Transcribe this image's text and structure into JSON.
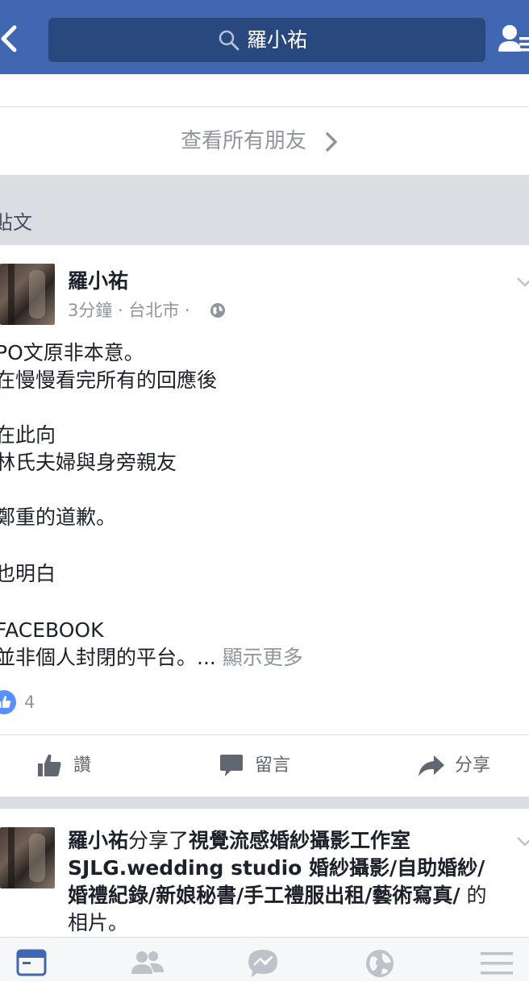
{
  "header": {
    "search_text": "羅小祐",
    "back_icon": "chevron-left-icon",
    "search_icon": "search-icon",
    "friend_requests_icon": "friend-requests-icon",
    "colors": {
      "bar": "#4267b2",
      "search": "#29487d"
    }
  },
  "friends": {
    "all_friends_label": "查看所有朋友"
  },
  "posts_section": {
    "title": "貼文"
  },
  "post1": {
    "author": "羅小祐",
    "meta": "3分鐘 · 台北市 ·",
    "lines": [
      "PO文原非本意。",
      "在慢慢看完所有的回應後",
      "",
      "在此向",
      "林氏夫婦與身旁親友",
      "",
      "鄭重的道歉。",
      "",
      "也明白",
      "",
      "FACEBOOK",
      "並非個人封閉的平台。..."
    ],
    "see_more": "顯示更多",
    "likes": "4"
  },
  "actions": {
    "like": "讚",
    "comment": "留言",
    "share": "分享"
  },
  "post2": {
    "author": "羅小祐",
    "shared_text": "分享了",
    "page_name": "視覺流感婚紗攝影工作室 SJLG.wedding studio 婚紗攝影/自助婚紗/婚禮紀錄/新娘秘書/手工禮服出租/藝術寫真/",
    "suffix": " 的相片。"
  },
  "tabbar": {
    "items": [
      "news-feed-icon",
      "friends-icon",
      "messenger-icon",
      "globe-icon",
      "menu-icon"
    ],
    "active_color": "#4267b2",
    "inactive_color": "#bec2c9"
  }
}
